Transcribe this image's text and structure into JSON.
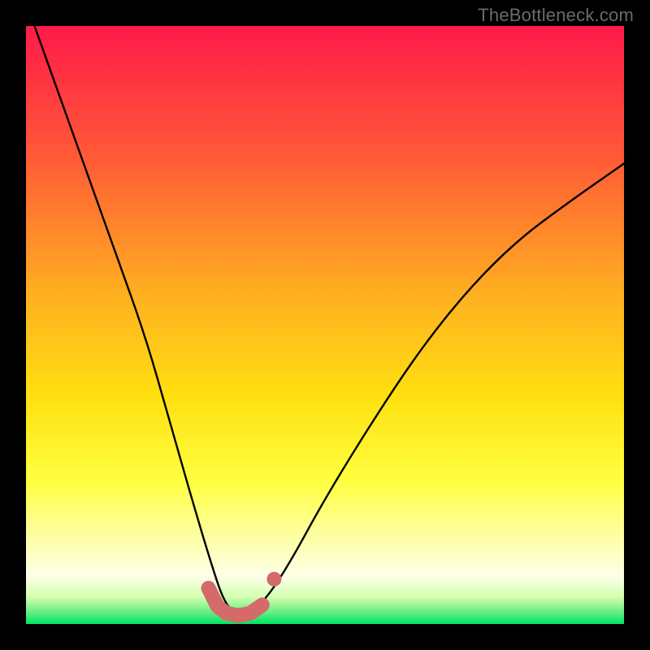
{
  "watermark": "TheBottleneck.com",
  "colors": {
    "gradient_top": "#ff1a4a",
    "gradient_mid1": "#ff7a2a",
    "gradient_mid2": "#ffd400",
    "gradient_mid3": "#ffff66",
    "gradient_mid4": "#fdffd0",
    "gradient_bottom": "#00e566",
    "curve": "#000000",
    "marker": "#d46a6a",
    "frame": "#000000"
  },
  "chart_data": {
    "type": "line",
    "title": "",
    "xlabel": "",
    "ylabel": "",
    "xlim": [
      0,
      1
    ],
    "ylim": [
      0,
      1
    ],
    "series": [
      {
        "name": "bottleneck-curve",
        "x": [
          0.0,
          0.05,
          0.1,
          0.15,
          0.2,
          0.24,
          0.28,
          0.31,
          0.33,
          0.35,
          0.37,
          0.4,
          0.44,
          0.5,
          0.58,
          0.66,
          0.74,
          0.82,
          0.9,
          1.0
        ],
        "y": [
          1.04,
          0.9,
          0.76,
          0.62,
          0.48,
          0.34,
          0.2,
          0.1,
          0.04,
          0.015,
          0.015,
          0.04,
          0.1,
          0.21,
          0.34,
          0.46,
          0.56,
          0.64,
          0.7,
          0.77
        ]
      }
    ],
    "markers": {
      "name": "highlighted-range",
      "color": "#d46a6a",
      "points": [
        {
          "x": 0.305,
          "y": 0.06
        },
        {
          "x": 0.32,
          "y": 0.03
        },
        {
          "x": 0.335,
          "y": 0.018
        },
        {
          "x": 0.355,
          "y": 0.014
        },
        {
          "x": 0.375,
          "y": 0.018
        },
        {
          "x": 0.395,
          "y": 0.032
        },
        {
          "x": 0.415,
          "y": 0.075
        }
      ]
    }
  }
}
